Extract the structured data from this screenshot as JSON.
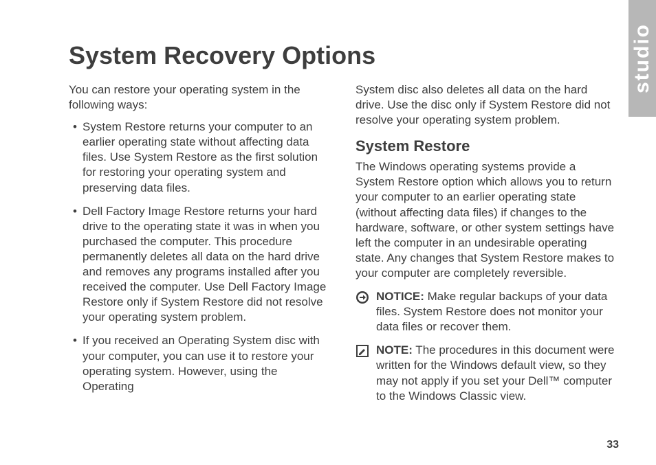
{
  "sideTab": "studio",
  "title": "System Recovery Options",
  "intro": "You can restore your operating system in the following ways:",
  "bullets": [
    "System Restore returns your computer to an earlier operating state without affecting data files. Use System Restore as the first solution for restoring your operating system and preserving data files.",
    "Dell Factory Image Restore returns your hard drive to the operating state it was in when you purchased the computer. This procedure permanently deletes all data on the hard drive and removes any programs installed after you received the computer. Use Dell Factory Image Restore only if System Restore did not resolve your operating system problem.",
    "If you received an Operating System disc with your computer, you can use it to restore your operating system. However, using the Operating"
  ],
  "col2_cont": "System disc also deletes all data on the hard drive. Use the disc only if System Restore did not resolve your operating system problem.",
  "subheading": "System Restore",
  "body": "The Windows operating systems provide a System Restore option which allows you to return your computer to an earlier operating state (without affecting data files) if changes to the hardware, software, or other system settings have left the computer in an undesirable operating state. Any changes that System Restore makes to your computer are completely reversible.",
  "notice_label": "NOTICE:",
  "notice_text": " Make regular backups of your data files. System Restore does not monitor your data files or recover them.",
  "note_label": "NOTE:",
  "note_text": " The procedures in this document were written for the Windows default view, so they may not apply if you set your Dell™ computer to the Windows Classic view.",
  "pageNumber": "33"
}
